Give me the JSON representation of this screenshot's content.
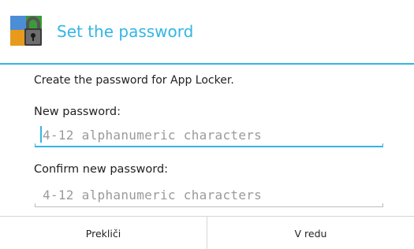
{
  "dialog": {
    "title": "Set the password",
    "icon": "lock-shield-icon",
    "message": "Create the password for App Locker.",
    "accent_color": "#33b5e5"
  },
  "new_password": {
    "label": "New password:",
    "placeholder": "4-12 alphanumeric characters",
    "value": ""
  },
  "confirm_password": {
    "label": "Confirm new password:",
    "placeholder": "4-12 alphanumeric characters",
    "value": ""
  },
  "buttons": {
    "cancel_label": "Prekliči",
    "ok_label": "V redu"
  }
}
